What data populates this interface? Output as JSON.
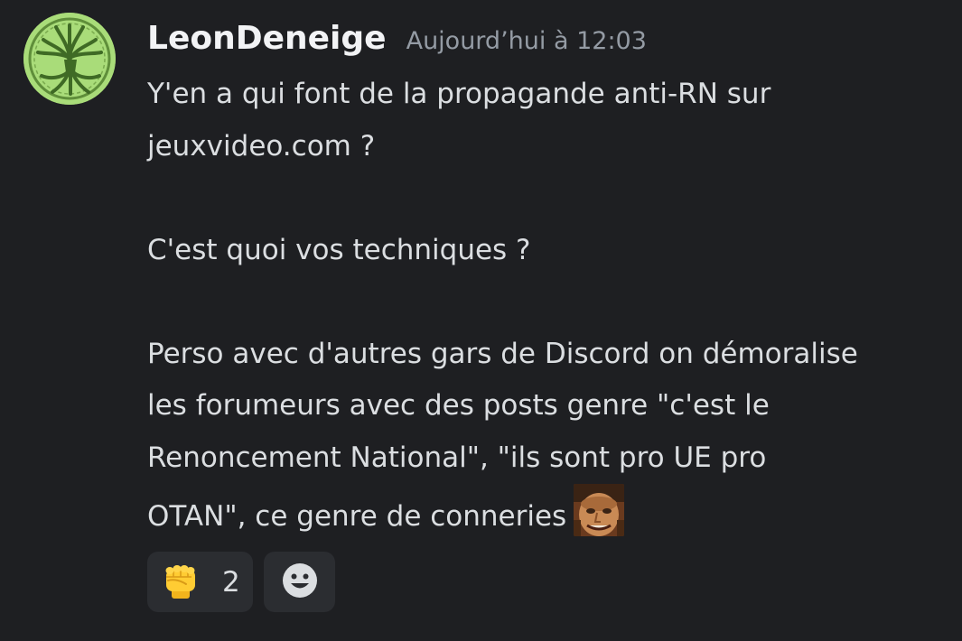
{
  "message": {
    "author": "LeonDeneige",
    "timestamp": "Aujourd’hui à 12:03",
    "lines": [
      "Y'en a qui font de la propagande anti-RN sur",
      "jeuxvideo.com ?",
      "C'est quoi vos techniques ?",
      "Perso avec d'autres gars de Discord on démoralise",
      "les forumeurs avec des posts genre \"c'est le",
      "Renoncement National\", \"ils sont pro UE pro",
      "OTAN\", ce genre de conneries"
    ],
    "inline_emoji": "custom-face-emoji"
  },
  "reactions": [
    {
      "icon": "raised-fist-icon",
      "count": "2"
    },
    {
      "icon": "add-reaction-smiley-icon"
    }
  ],
  "colors": {
    "background": "#1e1f22",
    "username": "#f2f3f5",
    "text": "#dbdee1",
    "timestamp": "#949ba4",
    "reaction_bg": "#2b2d31",
    "avatar_bg": "#a9dc79"
  }
}
